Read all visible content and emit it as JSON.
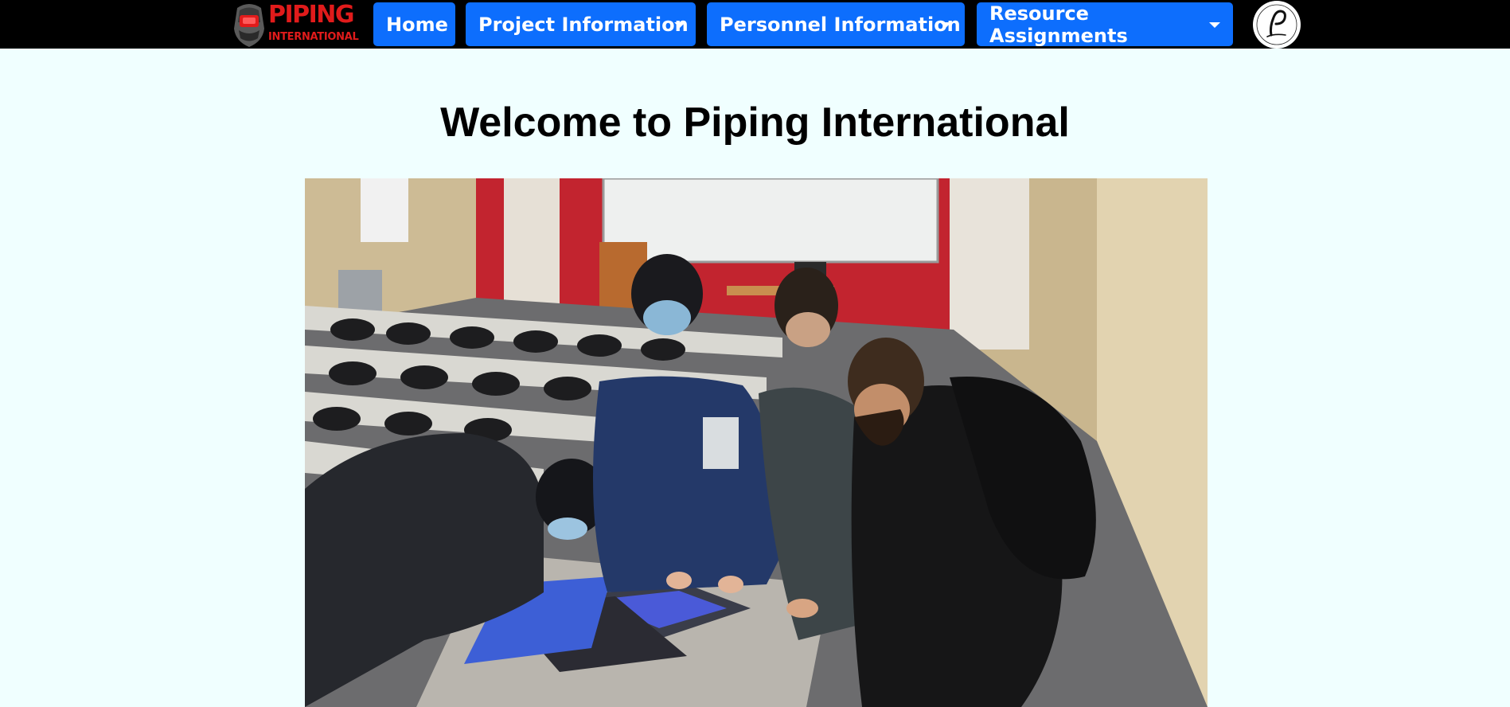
{
  "navbar": {
    "brand": {
      "main": "PIPING",
      "sub": "INTERNATIONAL"
    },
    "items": [
      {
        "label": "Home",
        "dropdown": false
      },
      {
        "label": "Project Information",
        "dropdown": true
      },
      {
        "label": "Personnel Information",
        "dropdown": true
      },
      {
        "label": "Resource Assignments",
        "dropdown": true
      }
    ],
    "profile_icon": "monogram-p-logo"
  },
  "main": {
    "title": "Welcome to Piping International",
    "hero_image": "group-photo-students-around-laptop"
  },
  "colors": {
    "nav_background": "#000000",
    "nav_button": "#0d6efd",
    "brand_red": "#e11b1b",
    "page_background": "#f0ffff"
  }
}
